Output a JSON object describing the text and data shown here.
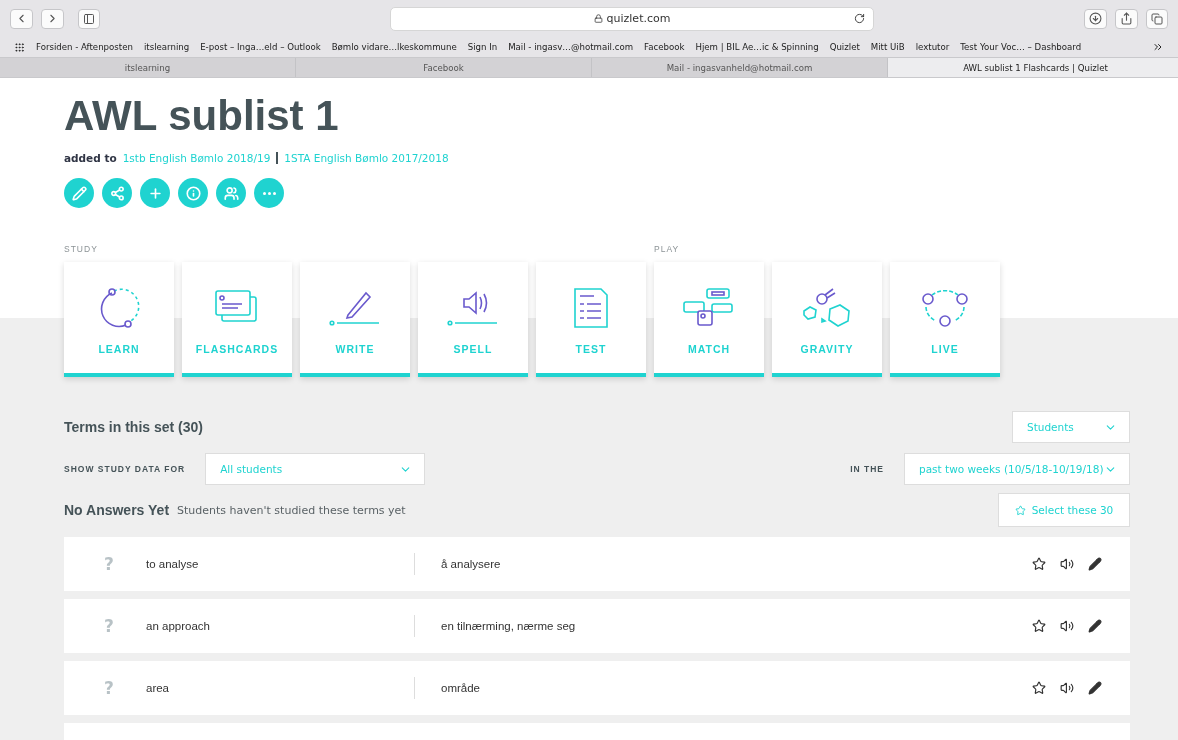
{
  "browser": {
    "url": "quizlet.com",
    "bookmarks": [
      "Forsiden - Aftenposten",
      "itslearning",
      "E-post – Inga…eld – Outlook",
      "Bømlo vidare…lkeskommune",
      "Sign In",
      "Mail - ingasv…@hotmail.com",
      "Facebook",
      "Hjem | BIL Ae…ic & Spinning",
      "Quizlet",
      "Mitt UiB",
      "lextutor",
      "Test Your Voc… – Dashboard"
    ],
    "tabs": [
      {
        "label": "itslearning",
        "selected": false
      },
      {
        "label": "Facebook",
        "selected": false
      },
      {
        "label": "Mail - ingasvanheld@hotmail.com",
        "selected": false
      },
      {
        "label": "AWL sublist 1 Flashcards | Quizlet",
        "selected": true
      }
    ]
  },
  "set": {
    "title": "AWL sublist 1",
    "added_to": "added to",
    "classes": [
      "1stb English Bømlo 2018/19",
      "1STA English Bømlo 2017/2018"
    ]
  },
  "mode_groups": [
    {
      "label": "STUDY",
      "modes": [
        {
          "kind": "learn",
          "label": "LEARN"
        },
        {
          "kind": "flashcards",
          "label": "FLASHCARDS"
        },
        {
          "kind": "write",
          "label": "WRITE"
        },
        {
          "kind": "spell",
          "label": "SPELL"
        },
        {
          "kind": "test",
          "label": "TEST"
        }
      ]
    },
    {
      "label": "PLAY",
      "modes": [
        {
          "kind": "match",
          "label": "MATCH"
        },
        {
          "kind": "gravity",
          "label": "GRAVITY"
        },
        {
          "kind": "live",
          "label": "LIVE"
        }
      ]
    }
  ],
  "terms": {
    "heading": "Terms in this set (30)",
    "view_select": "Students",
    "filter_label": "SHOW STUDY DATA FOR",
    "filter_value": "All students",
    "period_label": "IN THE",
    "period_value": "past two weeks (10/5/18-10/19/18)",
    "group": {
      "heading": "No Answers Yet",
      "note": "Students haven't studied these terms yet",
      "select_button": "Select these 30"
    },
    "rows": [
      {
        "mark": "?",
        "term": "to analyse",
        "definition": "å analysere"
      },
      {
        "mark": "?",
        "term": "an approach",
        "definition": "en tilnærming, nærme seg"
      },
      {
        "mark": "?",
        "term": "area",
        "definition": "område"
      }
    ]
  }
}
